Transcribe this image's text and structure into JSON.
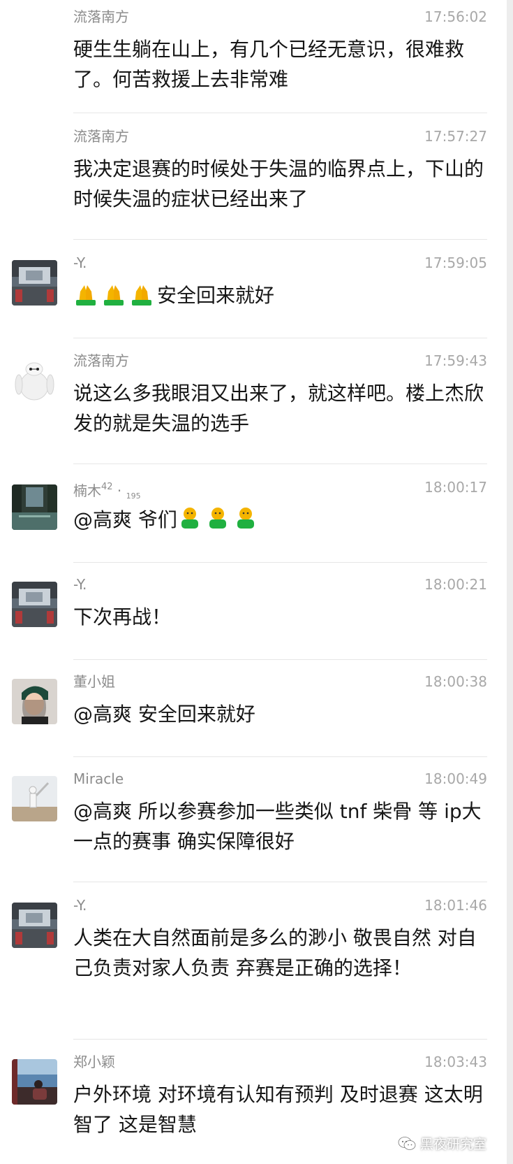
{
  "colors": {
    "background": "#ffffff",
    "name_text": "#8c8c8c",
    "time_text": "#a8a8a8",
    "message_text": "#161616",
    "divider": "#e6e6e6",
    "emoji_skin": "#f4b400",
    "emoji_green": "#20b040"
  },
  "messages": [
    {
      "name": "流落南方",
      "time": "17:56:02",
      "text": "硬生生躺在山上，有几个已经无意识，很难救了。何苦救援上去非常难"
    },
    {
      "name": "流落南方",
      "time": "17:57:27",
      "text": "我决定退赛的时候处于失温的临界点上，下山的时候失温的症状已经出来了"
    },
    {
      "name": "-Y.",
      "time": "17:59:05",
      "text": "安全回来就好",
      "emoji": [
        "folded-hands-icon",
        "folded-hands-icon",
        "folded-hands-icon"
      ]
    },
    {
      "name": "流落南方",
      "time": "17:59:43",
      "text": "说这么多我眼泪又出来了，就这样吧。楼上杰欣发的就是失温的选手"
    },
    {
      "name_main": "楠木",
      "name_sup": "42",
      "name_dot": " · ",
      "name_sub": "195",
      "time": "18:00:17",
      "text": "@高爽 爷们",
      "emoji": [
        "emoji-figure-icon",
        "emoji-figure-icon",
        "emoji-figure-icon"
      ]
    },
    {
      "name": "-Y.",
      "time": "18:00:21",
      "text": "下次再战！"
    },
    {
      "name": "董小姐",
      "time": "18:00:38",
      "text": "@高爽 安全回来就好"
    },
    {
      "name": "Miracle",
      "time": "18:00:49",
      "text": "@高爽 所以参赛参加一些类似 tnf 柴骨 等 ip大一点的赛事 确实保障很好"
    },
    {
      "name": "-Y.",
      "time": "18:01:46",
      "text": "人类在大自然面前是多么的渺小 敬畏自然 对自己负责对家人负责 弃赛是正确的选择！"
    },
    {
      "name": "郑小颖",
      "time": "18:03:43",
      "text": "户外环境 对环境有认知有预判 及时退赛 这太明智了 这是智慧"
    }
  ],
  "watermark": {
    "text": "黑夜研究室",
    "icon": "wechat-icon"
  }
}
